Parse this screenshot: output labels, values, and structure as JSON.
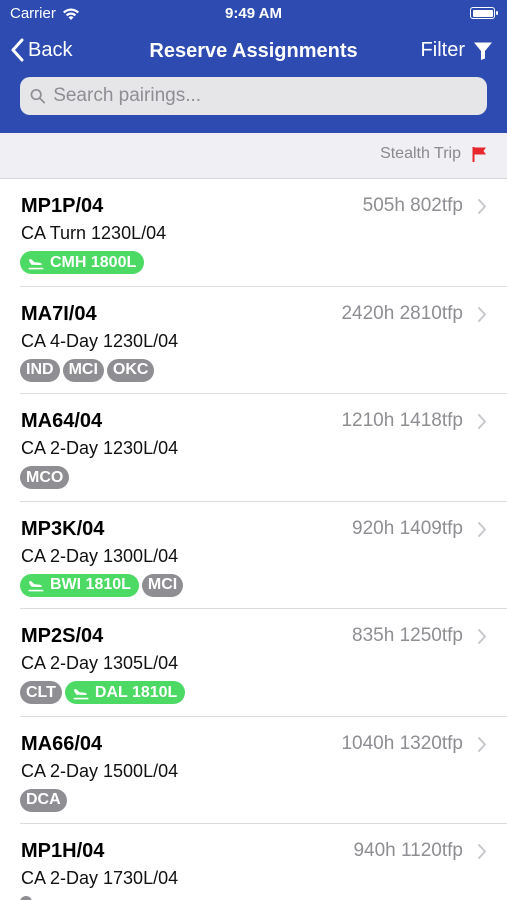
{
  "status": {
    "carrier": "Carrier",
    "time": "9:49 AM"
  },
  "nav": {
    "back_label": "Back",
    "title": "Reserve Assignments",
    "filter_label": "Filter"
  },
  "search": {
    "placeholder": "Search pairings..."
  },
  "legend": {
    "label": "Stealth Trip",
    "flag_color": "#e8262d"
  },
  "colors": {
    "header": "#2d4bb1",
    "tag_gray": "#8e8e93",
    "tag_green": "#4cd964"
  },
  "pairings": [
    {
      "id": "MP1P/04",
      "hours": "505h 802tfp",
      "desc": "CA Turn 1230L/04",
      "tags": [
        {
          "text": "CMH 1800L",
          "style": "green",
          "icon": "plane-landing-icon"
        }
      ]
    },
    {
      "id": "MA7I/04",
      "hours": "2420h 2810tfp",
      "desc": "CA 4-Day 1230L/04",
      "tags": [
        {
          "text": "IND",
          "style": "gray"
        },
        {
          "text": "MCI",
          "style": "gray"
        },
        {
          "text": "OKC",
          "style": "gray"
        }
      ]
    },
    {
      "id": "MA64/04",
      "hours": "1210h 1418tfp",
      "desc": "CA 2-Day 1230L/04",
      "tags": [
        {
          "text": "MCO",
          "style": "gray"
        }
      ]
    },
    {
      "id": "MP3K/04",
      "hours": "920h 1409tfp",
      "desc": "CA 2-Day 1300L/04",
      "tags": [
        {
          "text": "BWI 1810L",
          "style": "green",
          "icon": "plane-landing-icon"
        },
        {
          "text": "MCI",
          "style": "gray"
        }
      ]
    },
    {
      "id": "MP2S/04",
      "hours": "835h 1250tfp",
      "desc": "CA 2-Day 1305L/04",
      "tags": [
        {
          "text": "CLT",
          "style": "gray"
        },
        {
          "text": "DAL 1810L",
          "style": "green",
          "icon": "plane-landing-icon"
        }
      ]
    },
    {
      "id": "MA66/04",
      "hours": "1040h 1320tfp",
      "desc": "CA 2-Day 1500L/04",
      "tags": [
        {
          "text": "DCA",
          "style": "gray"
        }
      ]
    },
    {
      "id": "MP1H/04",
      "hours": "940h 1120tfp",
      "desc": "CA 2-Day 1730L/04",
      "tags": [
        {
          "text": "",
          "style": "gray"
        }
      ]
    }
  ]
}
